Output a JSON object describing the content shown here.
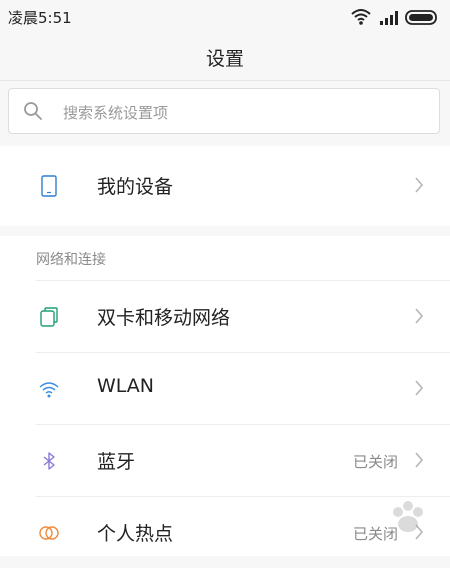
{
  "status_bar": {
    "time": "凌晨5:51",
    "icons": [
      "wifi-icon",
      "signal-icon",
      "battery-icon"
    ]
  },
  "header": {
    "title": "设置"
  },
  "search": {
    "placeholder": "搜索系统设置项",
    "icon": "search-icon"
  },
  "my_device": {
    "label": "我的设备",
    "icon": "phone-icon"
  },
  "network_section": {
    "header": "网络和连接",
    "items": [
      {
        "label": "双卡和移动网络",
        "icon": "sim-cards-icon",
        "value": ""
      },
      {
        "label": "WLAN",
        "icon": "wifi-icon",
        "value": ""
      },
      {
        "label": "蓝牙",
        "icon": "bluetooth-icon",
        "value": "已关闭"
      },
      {
        "label": "个人热点",
        "icon": "hotspot-icon",
        "value": "已关闭"
      }
    ]
  },
  "colors": {
    "phone_icon": "#2f7fd0",
    "sim_icon": "#1f9e74",
    "wifi_icon": "#3a8fe0",
    "bluetooth_icon": "#8a7ad8",
    "hotspot_icon": "#f08a3c"
  }
}
